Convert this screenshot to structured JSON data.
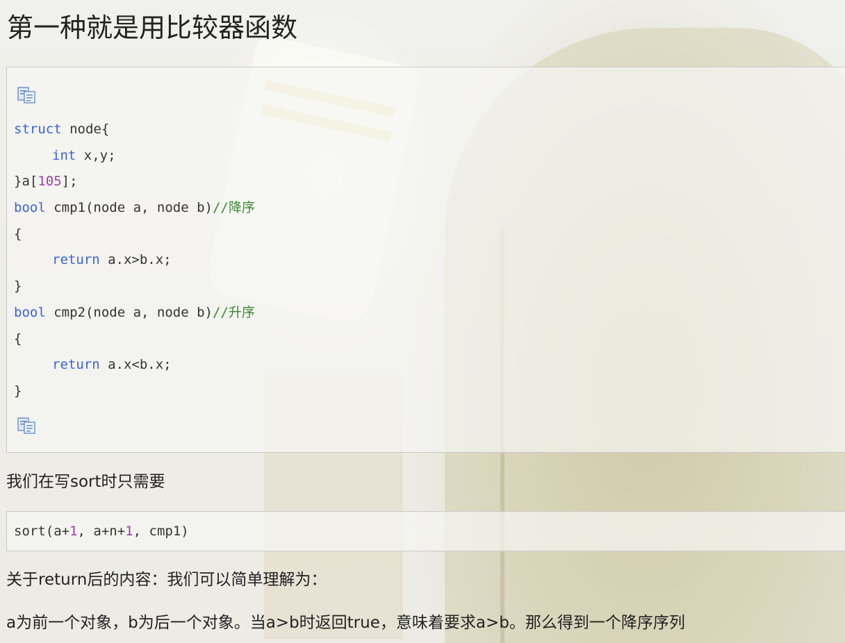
{
  "heading": "第一种就是用比较器函数",
  "code_block": {
    "copy_icon_top": "copy-icon",
    "copy_icon_bottom": "copy-icon",
    "lines": [
      [
        {
          "t": "struct",
          "c": "kw"
        },
        {
          "t": " node{",
          "c": ""
        }
      ],
      [
        {
          "t": "    ",
          "c": "indent"
        },
        {
          "t": "int",
          "c": "kw"
        },
        {
          "t": " x,y;",
          "c": ""
        }
      ],
      [
        {
          "t": "}a[",
          "c": ""
        },
        {
          "t": "105",
          "c": "num"
        },
        {
          "t": "];",
          "c": ""
        }
      ],
      [
        {
          "t": "bool",
          "c": "kw"
        },
        {
          "t": " cmp1(node a, node b)",
          "c": ""
        },
        {
          "t": "//降序",
          "c": "cmt"
        }
      ],
      [
        {
          "t": "{",
          "c": ""
        }
      ],
      [
        {
          "t": "    ",
          "c": "indent"
        },
        {
          "t": "return",
          "c": "kw"
        },
        {
          "t": " a.x>b.x;",
          "c": ""
        }
      ],
      [
        {
          "t": "}",
          "c": ""
        }
      ],
      [
        {
          "t": "bool",
          "c": "kw"
        },
        {
          "t": " cmp2(node a, node b)",
          "c": ""
        },
        {
          "t": "//升序",
          "c": "cmt"
        }
      ],
      [
        {
          "t": "{",
          "c": ""
        }
      ],
      [
        {
          "t": "    ",
          "c": "indent"
        },
        {
          "t": "return",
          "c": "kw"
        },
        {
          "t": " a.x<b.x;",
          "c": ""
        }
      ],
      [
        {
          "t": "}",
          "c": ""
        }
      ]
    ]
  },
  "paragraph_1": "我们在写sort时只需要",
  "inline_code": [
    {
      "t": "sort(a+",
      "c": ""
    },
    {
      "t": "1",
      "c": "num"
    },
    {
      "t": ", a+n+",
      "c": ""
    },
    {
      "t": "1",
      "c": "num"
    },
    {
      "t": ", cmp1)",
      "c": ""
    }
  ],
  "paragraph_2": "关于return后的内容：我们可以简单理解为：",
  "paragraph_3": "a为前一个对象，b为后一个对象。当a>b时返回true，意味着要求a>b。那么得到一个降序序列",
  "colors": {
    "keyword": "#3b63d9",
    "number": "#9a3ea8",
    "comment": "#3a8a2e",
    "code_border": "#c9c9c9"
  }
}
